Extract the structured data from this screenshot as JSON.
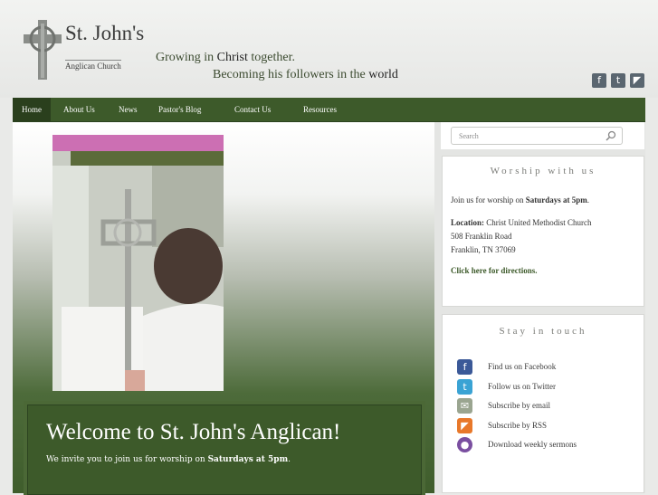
{
  "logo": {
    "name_line": "St. John's",
    "sub_line": "Anglican Church"
  },
  "tagline": {
    "line1_pre": "Growing in ",
    "line1_bold": "Christ",
    "line1_post": " together.",
    "line2_pre": "Becoming his followers in the ",
    "line2_bold": "world"
  },
  "social": [
    {
      "name": "facebook",
      "glyph": "f",
      "color": "#55626b"
    },
    {
      "name": "twitter",
      "glyph": "t",
      "color": "#55626b"
    },
    {
      "name": "rss",
      "glyph": "◤",
      "color": "#55626b"
    }
  ],
  "nav": {
    "items": [
      "Home",
      "About Us",
      "News",
      "Pastor's Blog",
      "Contact Us",
      "Resources"
    ],
    "active": "Home"
  },
  "welcome": {
    "title": "Welcome to St. John's Anglican!",
    "text_pre": "We invite you to join us for worship on ",
    "text_bold": "Saturdays at 5pm",
    "text_post": "."
  },
  "search": {
    "placeholder": "Search"
  },
  "worship": {
    "title": "Worship with us",
    "intro_pre": "Join us for worship on ",
    "intro_bold": "Saturdays at 5pm",
    "intro_post": ".",
    "location_label": "Location:",
    "location_name": " Christ United Methodist Church",
    "address1": "508 Franklin Road",
    "address2": "Franklin, TN 37069",
    "directions": "Click here for directions."
  },
  "touch": {
    "title": "Stay in touch",
    "items": [
      {
        "label": "Find us on Facebook",
        "icon": "facebook-icon",
        "glyph": "f",
        "color": "#3b5998"
      },
      {
        "label": "Follow us on Twitter",
        "icon": "twitter-icon",
        "glyph": "t",
        "color": "#3aa3d4"
      },
      {
        "label": "Subscribe by email",
        "icon": "email-icon",
        "glyph": "✉",
        "color": "#9aa590"
      },
      {
        "label": "Subscribe by RSS",
        "icon": "rss-icon",
        "glyph": "◤",
        "color": "#e8782a"
      },
      {
        "label": "Download weekly sermons",
        "icon": "podcast-icon",
        "glyph": "●",
        "color": "#7a4fa0"
      }
    ]
  },
  "colors": {
    "nav_green": "#3d5a2a",
    "accent_green": "#3d5a2a"
  }
}
